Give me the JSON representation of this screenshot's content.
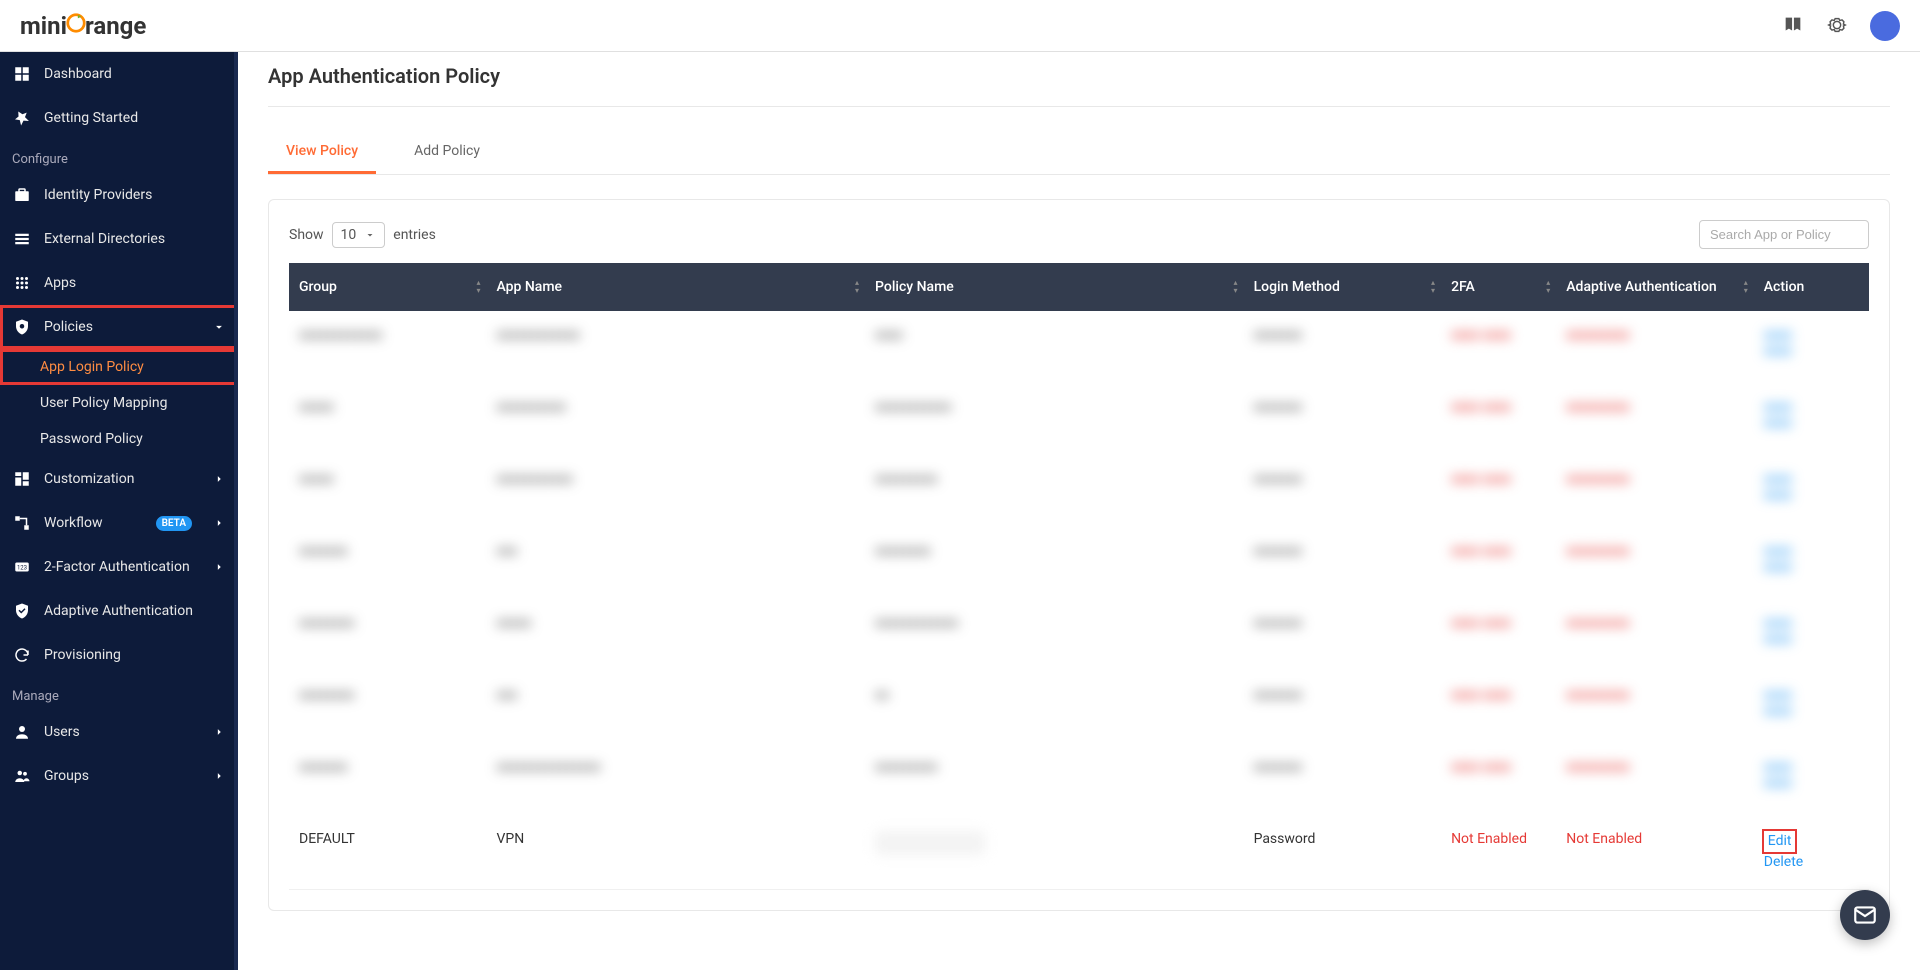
{
  "brand": {
    "part1": "mini",
    "part2": "range"
  },
  "sidebar": {
    "items": {
      "dashboard": "Dashboard",
      "getting_started": "Getting Started",
      "identity_providers": "Identity Providers",
      "external_directories": "External Directories",
      "apps": "Apps",
      "policies": "Policies",
      "customization": "Customization",
      "workflow": "Workflow",
      "two_factor": "2-Factor Authentication",
      "adaptive_auth": "Adaptive Authentication",
      "provisioning": "Provisioning",
      "users": "Users",
      "groups": "Groups"
    },
    "subitems": {
      "app_login_policy": "App Login Policy",
      "user_policy_mapping": "User Policy Mapping",
      "password_policy": "Password Policy"
    },
    "sections": {
      "configure": "Configure",
      "manage": "Manage"
    },
    "beta_badge": "BETA"
  },
  "page": {
    "title": "App Authentication Policy",
    "tabs": {
      "view": "View Policy",
      "add": "Add Policy"
    },
    "show_label": "Show",
    "entries_label": "entries",
    "page_size": "10",
    "search_placeholder": "Search App or Policy"
  },
  "table": {
    "headers": {
      "group": "Group",
      "app_name": "App Name",
      "policy_name": "Policy Name",
      "login_method": "Login Method",
      "tfa": "2FA",
      "adaptive_auth": "Adaptive Authentication",
      "action": "Action"
    },
    "visible_row": {
      "group": "DEFAULT",
      "app_name": "VPN",
      "policy_name": "",
      "login_method": "Password",
      "tfa": "Not Enabled",
      "adaptive_auth": "Not Enabled",
      "action_edit": "Edit",
      "action_delete": "Delete"
    }
  }
}
